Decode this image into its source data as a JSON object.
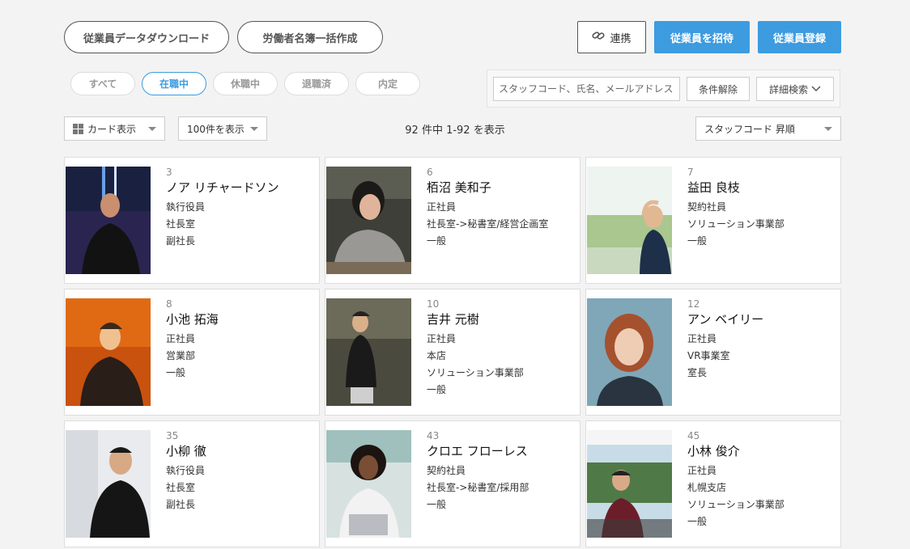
{
  "header": {
    "download_label": "従業員データダウンロード",
    "roster_label": "労働者名簿一括作成",
    "link_label": "連携",
    "link_icon": "link-icon",
    "invite_label": "従業員を招待",
    "register_label": "従業員登録"
  },
  "tabs": [
    {
      "label": "すべて"
    },
    {
      "label": "在職中"
    },
    {
      "label": "休職中"
    },
    {
      "label": "退職済"
    },
    {
      "label": "内定"
    }
  ],
  "search": {
    "placeholder": "スタッフコード、氏名、メールアドレス",
    "clear_label": "条件解除",
    "advanced_label": "詳細検索"
  },
  "toolbar": {
    "view_label": "カード表示",
    "per_page_label": "100件を表示",
    "count_text": "92 件中 1-92 を表示",
    "sort_label": "スタッフコード 昇順"
  },
  "employees": [
    {
      "code": "3",
      "name": "ノア リチャードソン",
      "lines": [
        "執行役員",
        "社長室",
        "副社長"
      ]
    },
    {
      "code": "6",
      "name": "栢沼 美和子",
      "lines": [
        "正社員",
        "社長室->秘書室/経営企画室",
        "一般"
      ]
    },
    {
      "code": "7",
      "name": "益田 良枝",
      "lines": [
        "契約社員",
        "ソリューション事業部",
        "一般"
      ]
    },
    {
      "code": "8",
      "name": "小池 拓海",
      "lines": [
        "正社員",
        "営業部",
        "一般"
      ]
    },
    {
      "code": "10",
      "name": "吉井 元樹",
      "lines": [
        "正社員",
        "本店",
        "ソリューション事業部",
        "一般"
      ]
    },
    {
      "code": "12",
      "name": "アン ベイリー",
      "lines": [
        "正社員",
        "VR事業室",
        "室長"
      ]
    },
    {
      "code": "35",
      "name": "小柳 徹",
      "lines": [
        "執行役員",
        "社長室",
        "副社長"
      ]
    },
    {
      "code": "43",
      "name": "クロエ フローレス",
      "lines": [
        "契約社員",
        "社長室->秘書室/採用部",
        "一般"
      ]
    },
    {
      "code": "45",
      "name": "小林 俊介",
      "lines": [
        "正社員",
        "札幌支店",
        "ソリューション事業部",
        "一般"
      ]
    }
  ]
}
